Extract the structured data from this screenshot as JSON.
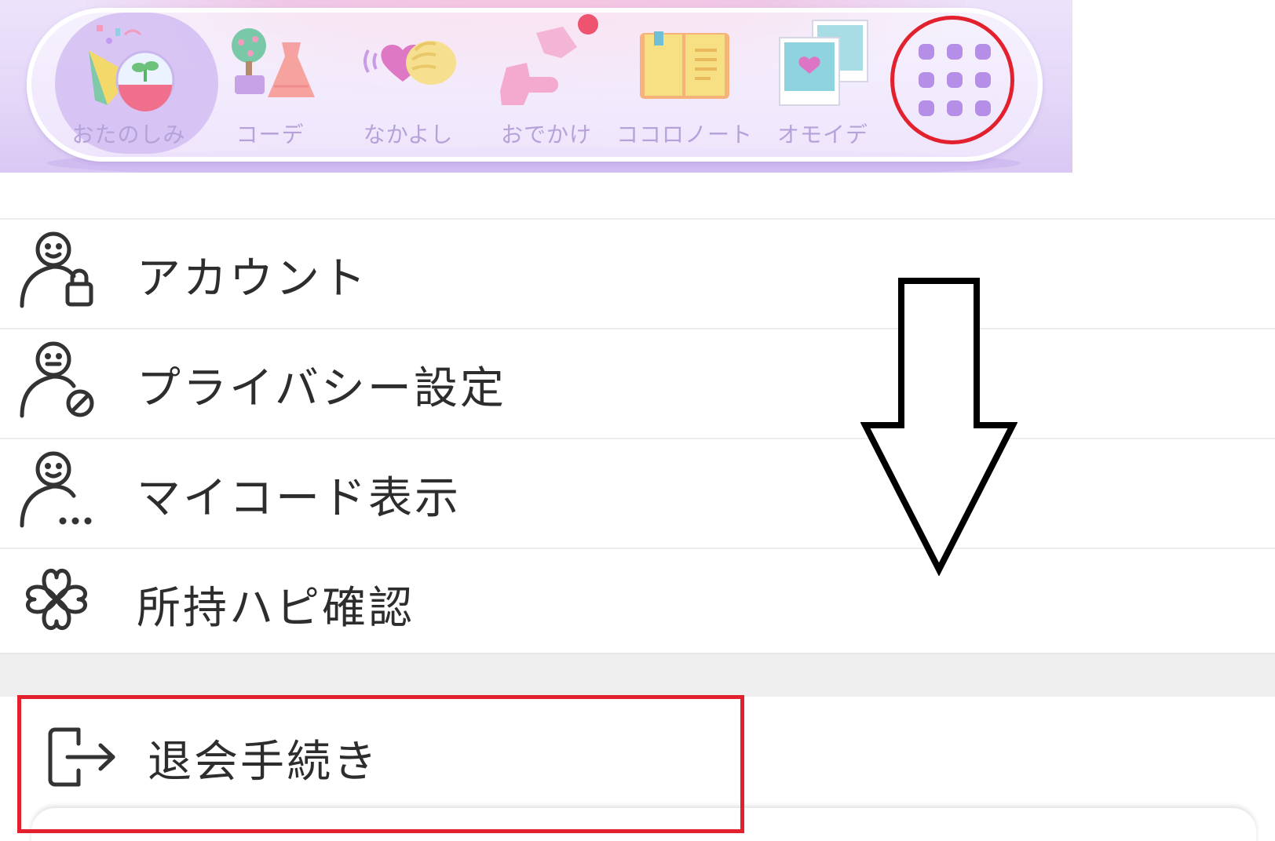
{
  "nav": {
    "items": [
      {
        "label": "おたのしみ",
        "icon": "party-terrarium-icon",
        "active": true
      },
      {
        "label": "コーデ",
        "icon": "dress-tree-icon",
        "active": false
      },
      {
        "label": "なかよし",
        "icon": "hand-heart-icon",
        "active": false
      },
      {
        "label": "おでかけ",
        "icon": "shoes-icon",
        "active": false,
        "badge": true
      },
      {
        "label": "ココロノート",
        "icon": "notebook-icon",
        "active": false
      },
      {
        "label": "オモイデ",
        "icon": "photos-icon",
        "active": false
      }
    ],
    "menu_button_icon": "grid-menu-icon",
    "accent_color": "#b58ee8",
    "badge_color": "#ee5470"
  },
  "settings": {
    "items": [
      {
        "label": "アカウント",
        "icon": "user-lock-icon"
      },
      {
        "label": "プライバシー設定",
        "icon": "user-block-icon"
      },
      {
        "label": "マイコード表示",
        "icon": "user-more-icon"
      },
      {
        "label": "所持ハピ確認",
        "icon": "clover-icon"
      }
    ],
    "withdraw": {
      "label": "退会手続き",
      "icon": "logout-icon"
    }
  },
  "annotations": {
    "highlight_color": "#e3202d",
    "arrow": "down-arrow"
  }
}
